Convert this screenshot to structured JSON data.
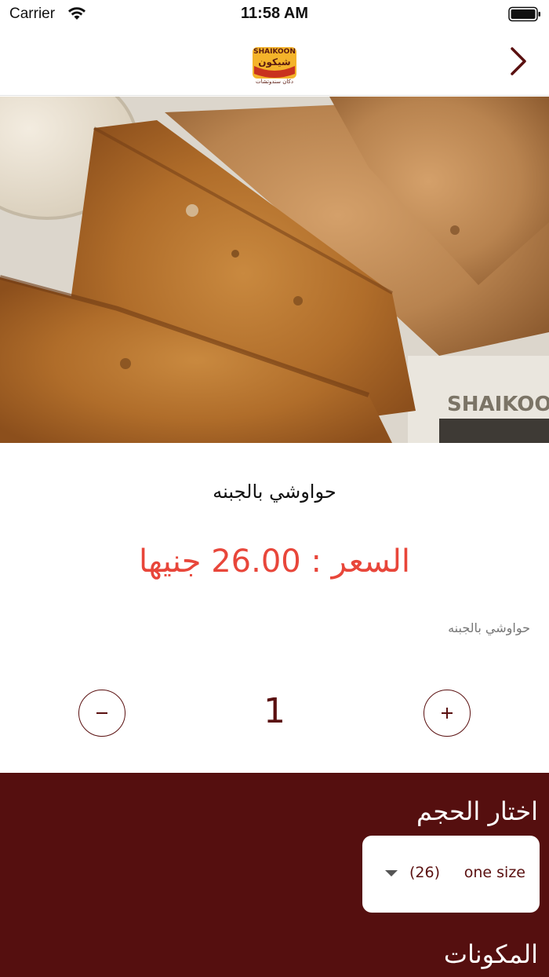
{
  "status_bar": {
    "carrier": "Carrier",
    "time": "11:58 AM"
  },
  "nav": {
    "logo_text": "SHAIKOON",
    "logo_subtext": "دكان سندوتشات",
    "forward_icon": "chevron-right-icon"
  },
  "product": {
    "title": "حواوشي بالجبنه",
    "price_label": "السعر :",
    "price_value": "26.00",
    "currency": "جنيها",
    "price_display": "السعر :  26.00 جنيها",
    "description": "حواوشي بالجبنه"
  },
  "quantity": {
    "value": "1",
    "minus_label": "−",
    "plus_label": "+"
  },
  "options": {
    "size_heading": "اختار الحجم",
    "selected_size": "one size",
    "selected_size_price": "(26)",
    "ingredients_heading": "المكونات"
  },
  "colors": {
    "brand_maroon": "#550f0f",
    "price_red": "#e8463a"
  }
}
